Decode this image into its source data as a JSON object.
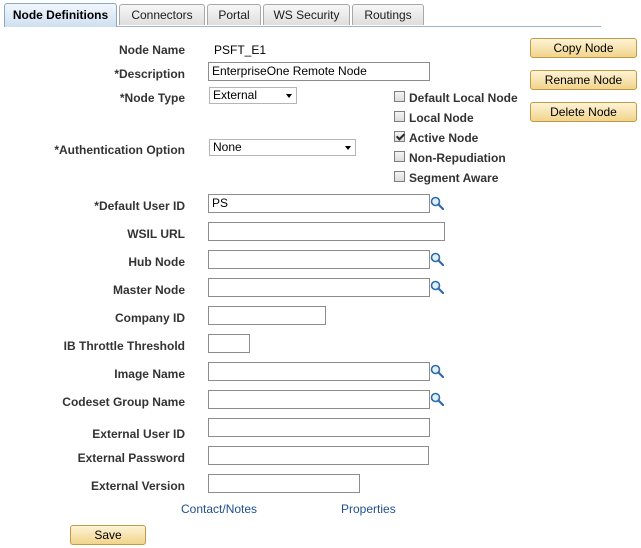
{
  "tabs": [
    {
      "label": "Node Definitions",
      "active": true
    },
    {
      "label": "Connectors",
      "active": false
    },
    {
      "label": "Portal",
      "active": false
    },
    {
      "label": "WS Security",
      "active": false
    },
    {
      "label": "Routings",
      "active": false
    }
  ],
  "form": {
    "node_name_label": "Node Name",
    "node_name_value": "PSFT_E1",
    "description_label": "*Description",
    "description_value": "EnterpriseOne Remote Node",
    "node_type_label": "*Node Type",
    "node_type_value": "External",
    "auth_option_label": "*Authentication Option",
    "auth_option_value": "None",
    "default_user_id_label": "*Default User ID",
    "default_user_id_value": "PS",
    "wsil_url_label": "WSIL URL",
    "wsil_url_value": "",
    "hub_node_label": "Hub Node",
    "hub_node_value": "",
    "master_node_label": "Master Node",
    "master_node_value": "",
    "company_id_label": "Company ID",
    "company_id_value": "",
    "ib_throttle_label": "IB Throttle Threshold",
    "ib_throttle_value": "",
    "image_name_label": "Image Name",
    "image_name_value": "",
    "codeset_group_label": "Codeset Group Name",
    "codeset_group_value": "",
    "external_user_id_label": "External User ID",
    "external_user_id_value": "",
    "external_password_label": "External Password",
    "external_password_value": "",
    "external_version_label": "External Version",
    "external_version_value": ""
  },
  "checkboxes": [
    {
      "label": "Default Local Node",
      "checked": false
    },
    {
      "label": "Local Node",
      "checked": false
    },
    {
      "label": "Active Node",
      "checked": true
    },
    {
      "label": "Non-Repudiation",
      "checked": false
    },
    {
      "label": "Segment Aware",
      "checked": false
    }
  ],
  "actions": {
    "copy_node": "Copy Node",
    "rename_node": "Rename Node",
    "delete_node": "Delete Node",
    "save": "Save"
  },
  "links": {
    "contact_notes": "Contact/Notes",
    "properties": "Properties"
  },
  "icons": {
    "lookup": "magnifier-lookup-icon",
    "dropdown": "chevron-down-icon",
    "checkmark": "check-icon"
  },
  "colors": {
    "tab_active_bg": "#cfe0f0",
    "button_bg": "#f1d48b",
    "link": "#1f4f8e",
    "label": "#333333"
  }
}
